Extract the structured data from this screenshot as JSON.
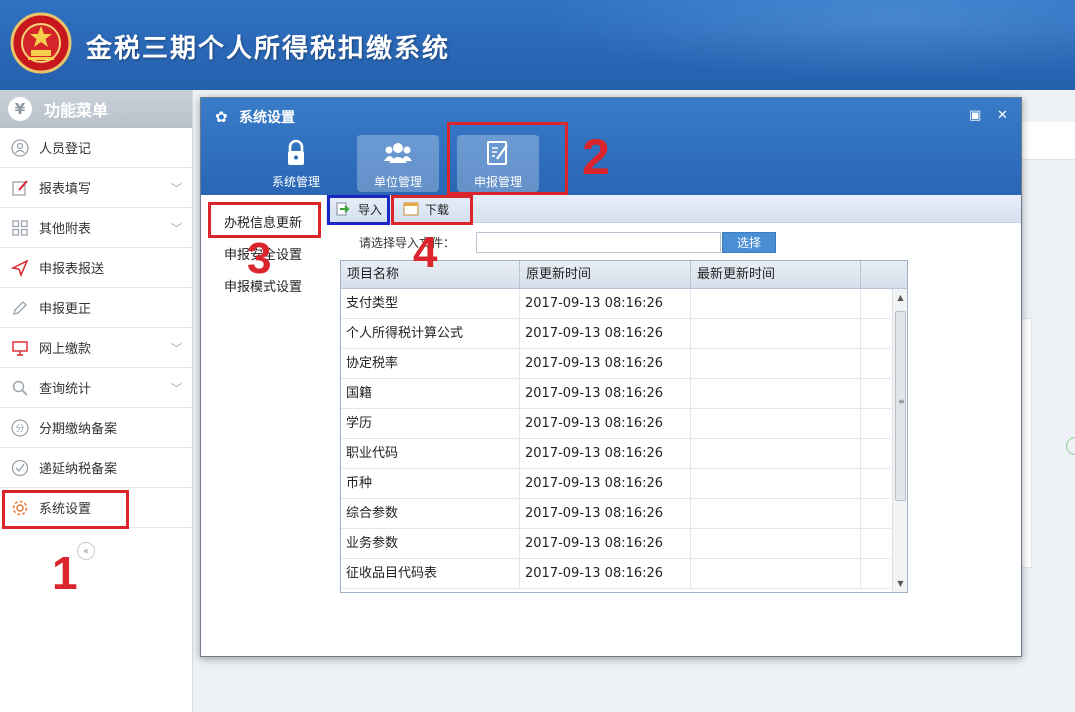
{
  "app": {
    "title": "金税三期个人所得税扣缴系统"
  },
  "sidebar": {
    "header_label": "功能菜单",
    "header_icon": "yen-icon",
    "items": [
      {
        "label": "人员登记",
        "icon": "person-icon",
        "expandable": false
      },
      {
        "label": "报表填写",
        "icon": "edit-icon",
        "expandable": true
      },
      {
        "label": "其他附表",
        "icon": "grid-icon",
        "expandable": true
      },
      {
        "label": "申报表报送",
        "icon": "send-icon",
        "expandable": false
      },
      {
        "label": "申报更正",
        "icon": "pencil-icon",
        "expandable": false
      },
      {
        "label": "网上缴款",
        "icon": "monitor-icon",
        "expandable": true
      },
      {
        "label": "查询统计",
        "icon": "search-icon",
        "expandable": true
      },
      {
        "label": "分期缴纳备案",
        "icon": "fen-icon",
        "expandable": false
      },
      {
        "label": "递延纳税备案",
        "icon": "clock-check-icon",
        "expandable": false
      },
      {
        "label": "系统设置",
        "icon": "gear-icon",
        "expandable": false
      }
    ],
    "collapse_icon": "double-chevron-left-icon"
  },
  "dialog": {
    "title": "系统设置",
    "controls": [
      "maximize-icon",
      "close-icon"
    ],
    "tabs": [
      {
        "label": "系统管理",
        "icon": "lock-icon",
        "highlighted": false
      },
      {
        "label": "单位管理",
        "icon": "users-icon",
        "highlighted": true
      },
      {
        "label": "申报管理",
        "icon": "report-edit-icon",
        "highlighted": true
      }
    ],
    "left_menu": [
      "办税信息更新",
      "申报安全设置",
      "申报模式设置"
    ],
    "toolbar": {
      "import_label": "导入",
      "download_label": "下载"
    },
    "import": {
      "label": "请选择导入文件：",
      "value": "",
      "browse_label": "选择"
    },
    "grid": {
      "columns": [
        "项目名称",
        "原更新时间",
        "最新更新时间"
      ],
      "rows": [
        [
          "支付类型",
          "2017-09-13 08:16:26",
          ""
        ],
        [
          "个人所得税计算公式",
          "2017-09-13 08:16:26",
          ""
        ],
        [
          "协定税率",
          "2017-09-13 08:16:26",
          ""
        ],
        [
          "国籍",
          "2017-09-13 08:16:26",
          ""
        ],
        [
          "学历",
          "2017-09-13 08:16:26",
          ""
        ],
        [
          "职业代码",
          "2017-09-13 08:16:26",
          ""
        ],
        [
          "币种",
          "2017-09-13 08:16:26",
          ""
        ],
        [
          "综合参数",
          "2017-09-13 08:16:26",
          ""
        ],
        [
          "业务参数",
          "2017-09-13 08:16:26",
          ""
        ],
        [
          "征收品目代码表",
          "2017-09-13 08:16:26",
          ""
        ]
      ]
    }
  },
  "annotations": {
    "n1": "1",
    "n2": "2",
    "n3": "3",
    "n4": "4",
    "red": "#d9252b",
    "blue": "#1927c6"
  }
}
